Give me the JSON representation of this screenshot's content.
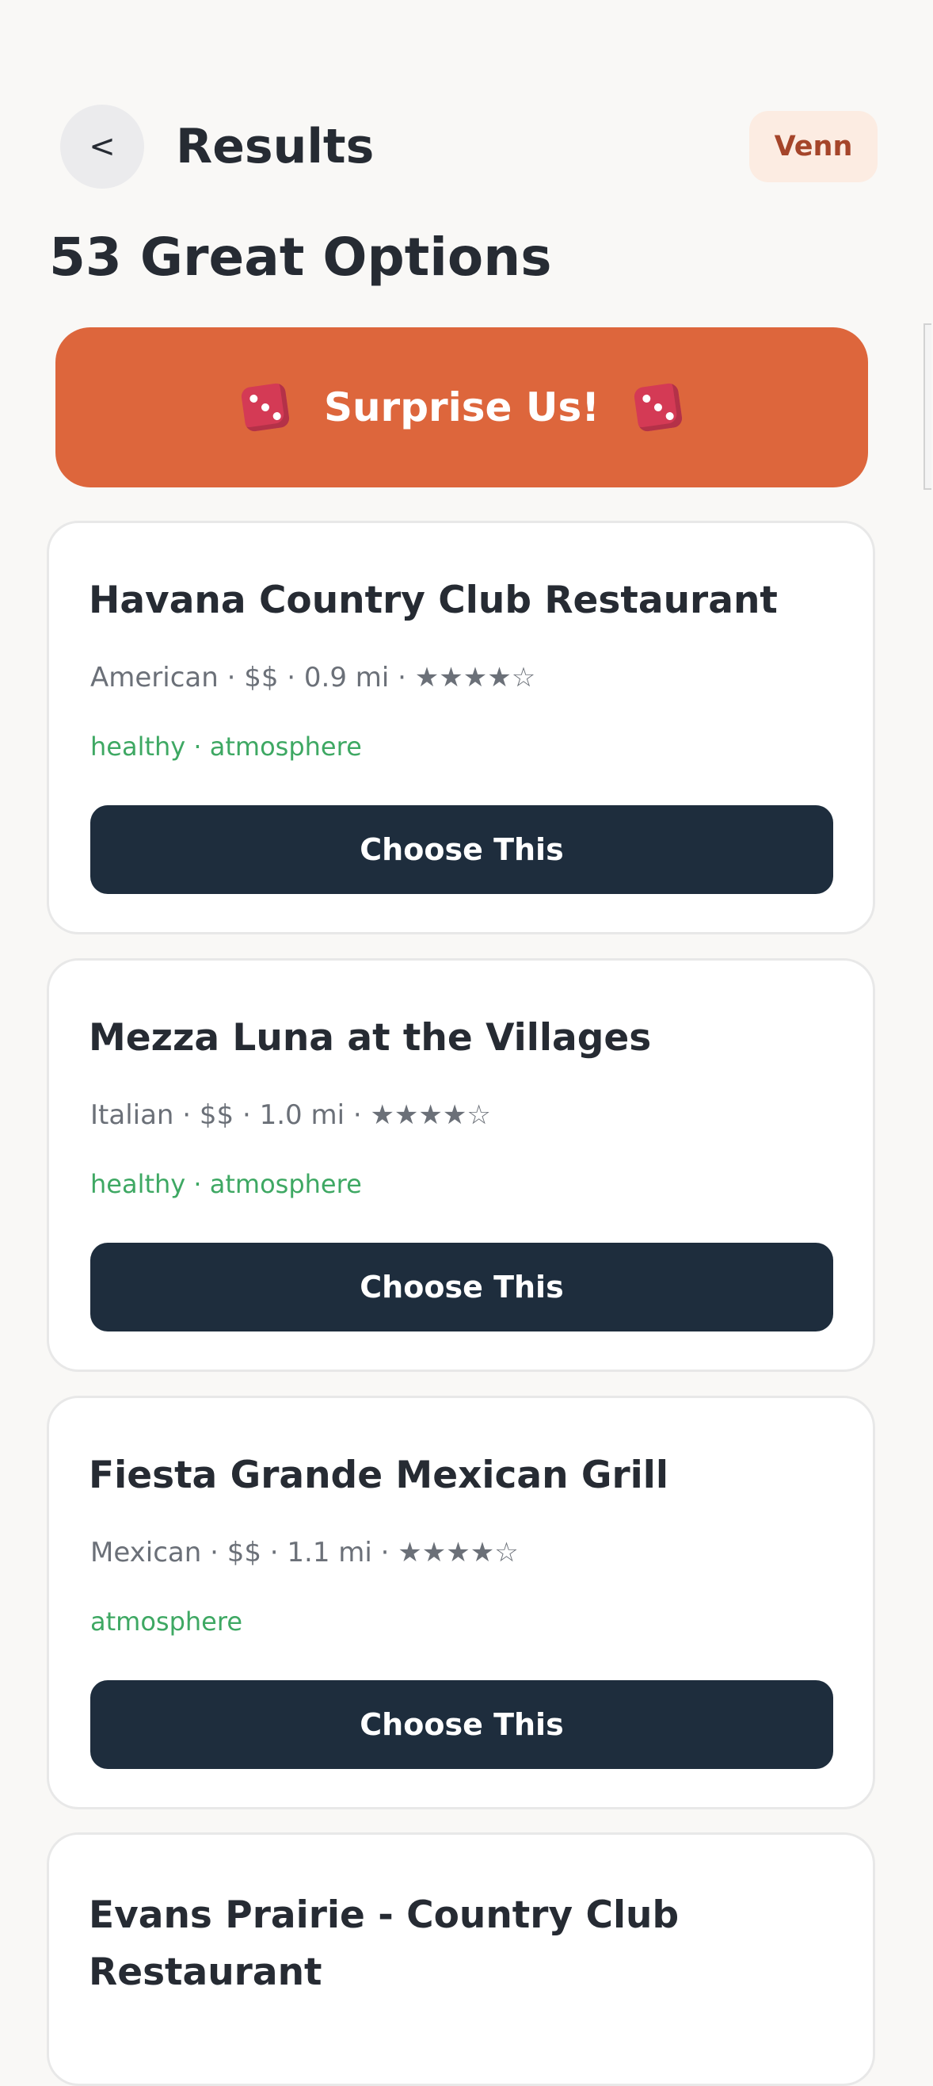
{
  "header": {
    "back_label": "<",
    "title": "Results",
    "badge": "Venn"
  },
  "summary": {
    "count_heading": "53 Great Options"
  },
  "surprise": {
    "label": "Surprise Us!",
    "icon_left": "dice-icon",
    "icon_right": "dice-icon"
  },
  "results": [
    {
      "name": "Havana Country Club Restaurant",
      "meta": "American · $$ · 0.9 mi · ★★★★☆",
      "tags": "healthy · atmosphere",
      "cta": "Choose This"
    },
    {
      "name": "Mezza Luna at the Villages",
      "meta": "Italian · $$ · 1.0 mi · ★★★★☆",
      "tags": "healthy · atmosphere",
      "cta": "Choose This"
    },
    {
      "name": "Fiesta Grande Mexican Grill",
      "meta": "Mexican · $$ · 1.1 mi · ★★★★☆",
      "tags": "atmosphere",
      "cta": "Choose This"
    },
    {
      "name": "Evans Prairie - Country Club Restaurant"
    }
  ],
  "colors": {
    "background": "#f9f8f6",
    "accent_orange": "#dd663c",
    "button_dark": "#1e2d3d",
    "tag_green": "#3ea863",
    "badge_bg": "#fcece2",
    "badge_text": "#a5452a"
  }
}
